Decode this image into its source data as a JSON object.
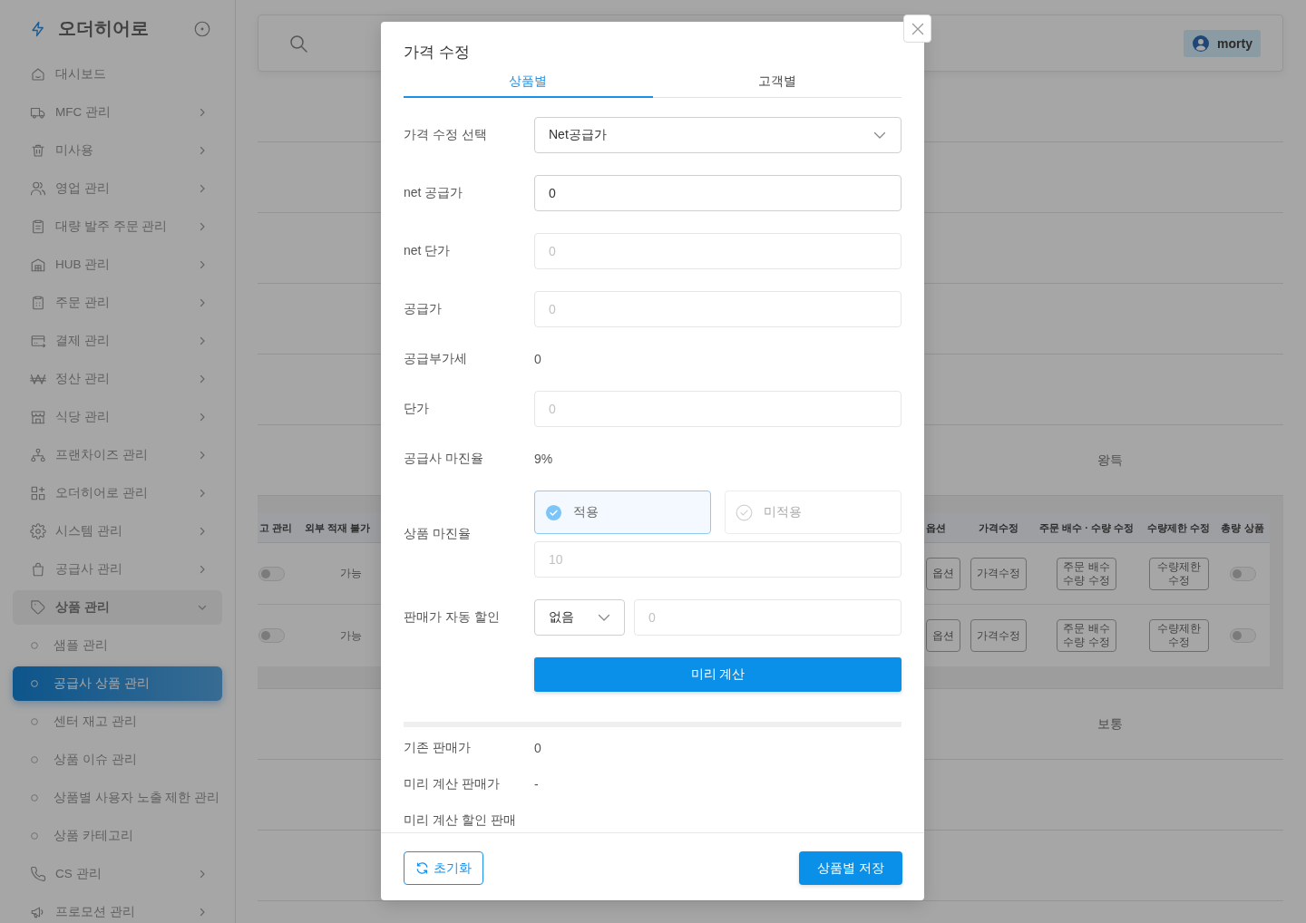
{
  "sidebar": {
    "logo": "오더히어로",
    "items": [
      {
        "kind": "link",
        "label": "대시보드",
        "selected": false
      },
      {
        "kind": "group",
        "label": "MFC 관리",
        "expanded": false
      },
      {
        "kind": "group",
        "label": "미사용",
        "expanded": false
      },
      {
        "kind": "group",
        "label": "영업 관리",
        "expanded": false
      },
      {
        "kind": "group",
        "label": "대량 발주 주문 관리",
        "expanded": false
      },
      {
        "kind": "group",
        "label": "HUB 관리",
        "expanded": false
      },
      {
        "kind": "group",
        "label": "주문 관리",
        "expanded": false
      },
      {
        "kind": "group",
        "label": "결제 관리",
        "expanded": false
      },
      {
        "kind": "group",
        "label": "정산 관리",
        "expanded": false
      },
      {
        "kind": "group",
        "label": "식당 관리",
        "expanded": false
      },
      {
        "kind": "group",
        "label": "프랜차이즈 관리",
        "expanded": false
      },
      {
        "kind": "group",
        "label": "오더히어로 관리",
        "expanded": false
      },
      {
        "kind": "group",
        "label": "시스템 관리",
        "expanded": false
      },
      {
        "kind": "group",
        "label": "공급사 관리",
        "expanded": false
      },
      {
        "kind": "group",
        "label": "상품 관리",
        "expanded": true,
        "children": [
          {
            "label": "샘플 관리",
            "selected": false
          },
          {
            "label": "공급사 상품 관리",
            "selected": true
          },
          {
            "label": "센터 재고 관리",
            "selected": false
          },
          {
            "label": "상품 이슈 관리",
            "selected": false
          },
          {
            "label": "상품별 사용자 노출 제한 관리",
            "selected": false
          },
          {
            "label": "상품 카테고리",
            "selected": false
          }
        ]
      },
      {
        "kind": "group",
        "label": "CS 관리",
        "expanded": false
      },
      {
        "kind": "group",
        "label": "프로모션 관리",
        "expanded": false
      }
    ]
  },
  "header": {
    "user": "morty"
  },
  "table": {
    "rows": [
      {
        "cell": "왕특",
        "detail": {
          "columns": [
            "고 관리",
            "외부 적재 불가",
            "옵션",
            "가격수정",
            "주문 배수 · 수량 수정",
            "수량제한 수정",
            "총량 상품"
          ],
          "rows": [
            {
              "cells": [
                {
                  "kind": "toggle",
                  "on": false
                },
                {
                  "kind": "text",
                  "text": "가능"
                },
                {
                  "kind": "button",
                  "label": "옵션"
                },
                {
                  "kind": "button",
                  "label": "가격수정"
                },
                {
                  "kind": "button",
                  "label": "주문 배수 수량 수정"
                },
                {
                  "kind": "button",
                  "label": "수량제한 수정"
                },
                {
                  "kind": "toggle",
                  "on": false
                }
              ]
            },
            {
              "cells": [
                {
                  "kind": "toggle",
                  "on": false
                },
                {
                  "kind": "text",
                  "text": "가능"
                },
                {
                  "kind": "button",
                  "label": "옵션"
                },
                {
                  "kind": "button",
                  "label": "가격수정"
                },
                {
                  "kind": "button",
                  "label": "주문 배수 수량 수정"
                },
                {
                  "kind": "button",
                  "label": "수량제한 수정"
                },
                {
                  "kind": "toggle",
                  "on": false
                }
              ]
            }
          ]
        }
      },
      {
        "cell": "보통"
      }
    ]
  },
  "modal": {
    "title": "가격 수정",
    "tabs": [
      {
        "label": "상품별",
        "selected": true
      },
      {
        "label": "고객별",
        "selected": false
      }
    ],
    "fields": [
      {
        "kind": "select",
        "label": "가격 수정 선택",
        "value": "Net공급가"
      },
      {
        "kind": "input",
        "label": "net 공급가",
        "value": "0",
        "disabled": false
      },
      {
        "kind": "input",
        "label": "net 단가",
        "placeholder": "0",
        "disabled": true
      },
      {
        "kind": "input",
        "label": "공급가",
        "placeholder": "0",
        "disabled": true
      },
      {
        "kind": "text",
        "label": "공급부가세",
        "value": "0"
      },
      {
        "kind": "input",
        "label": "단가",
        "placeholder": "0",
        "disabled": true
      },
      {
        "kind": "text",
        "label": "공급사 마진율",
        "value": "9%"
      },
      {
        "kind": "margin",
        "label": "상품 마진율",
        "options": [
          {
            "label": "적용",
            "selected": true
          },
          {
            "label": "미적용",
            "selected": false
          }
        ],
        "placeholder": "10",
        "disabled": true
      },
      {
        "kind": "discount",
        "label": "판매가 자동 할인",
        "select": "없음",
        "placeholder": "0",
        "disabled": true
      }
    ],
    "calc_button": "미리 계산",
    "results": [
      {
        "label": "기존 판매가",
        "value": "0"
      },
      {
        "label": "미리 계산 판매가",
        "value": "-"
      },
      {
        "label": "미리 계산 할인 판매"
      }
    ],
    "reset_button": "초기화",
    "save_button": "상품별 저장"
  }
}
